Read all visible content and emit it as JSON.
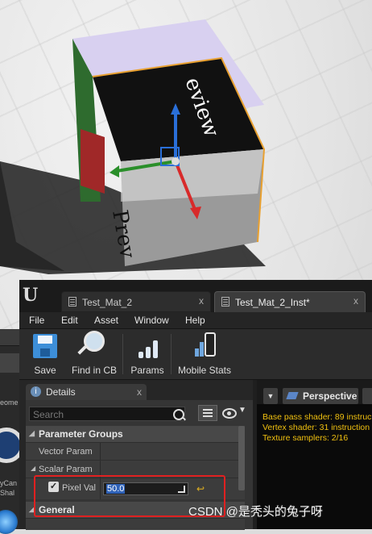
{
  "window": {
    "tabs": [
      {
        "label": "Test_Mat_2",
        "close": "x"
      },
      {
        "label": "Test_Mat_2_Inst*",
        "close": "x"
      }
    ],
    "logo": "U"
  },
  "menu": [
    "File",
    "Edit",
    "Asset",
    "Window",
    "Help"
  ],
  "toolbar": {
    "save_label": "Save",
    "find_label": "Find in CB",
    "params_label": "Params",
    "mobile_label": "Mobile Stats"
  },
  "details": {
    "tab_label": "Details",
    "tab_close": "x",
    "search_placeholder": "Search",
    "categories": {
      "parameter_groups": "Parameter Groups",
      "general": "General"
    },
    "rows": {
      "vector_param": "Vector Param",
      "scalar_param": "Scalar Param",
      "pixel_val": "Pixel Val",
      "pixel_val_value": "50.0",
      "pixel_val_checked": true
    }
  },
  "viewport": {
    "mode_label": "Perspective",
    "stats": [
      "Base pass shader: 89 instruc",
      "Vertex shader: 31 instruction",
      "Texture samplers: 2/16"
    ],
    "cube_text": "eview",
    "cube_text_bottom": "Prev"
  },
  "behind": {
    "labels": [
      "eome",
      "yCan",
      "Shal"
    ]
  },
  "watermark": "CSDN @是秃头的兔子呀",
  "colors": {
    "highlight": "#e02020",
    "selection": "#2f62b8",
    "stats_text": "#f0c010",
    "cube_outline": "#e8a030"
  }
}
